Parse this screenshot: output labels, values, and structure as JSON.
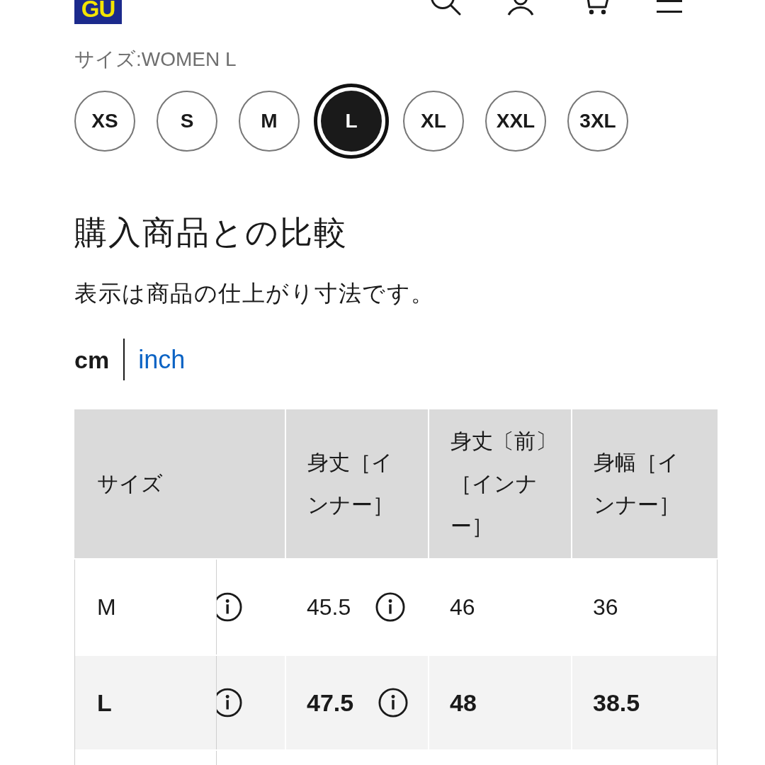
{
  "header": {
    "logo": "GU"
  },
  "size_selector": {
    "label": "サイズ:WOMEN L",
    "options": [
      {
        "label": "XS",
        "selected": false
      },
      {
        "label": "S",
        "selected": false
      },
      {
        "label": "M",
        "selected": false
      },
      {
        "label": "L",
        "selected": true
      },
      {
        "label": "XL",
        "selected": false
      },
      {
        "label": "XXL",
        "selected": false
      },
      {
        "label": "3XL",
        "selected": false
      }
    ]
  },
  "comparison": {
    "title": "購入商品との比較",
    "note": "表示は商品の仕上がり寸法です。",
    "units": [
      {
        "label": "cm",
        "selected": true
      },
      {
        "label": "inch",
        "selected": false
      }
    ]
  },
  "table": {
    "columns": [
      "サイズ",
      "身丈［インナー］",
      "身丈〔前〕［インナー］",
      "身幅［インナー］"
    ],
    "rows": [
      {
        "selected": false,
        "cells": [
          "M",
          "45.5",
          "46",
          "36"
        ]
      },
      {
        "selected": true,
        "cells": [
          "L",
          "47.5",
          "48",
          "38.5"
        ]
      }
    ]
  }
}
